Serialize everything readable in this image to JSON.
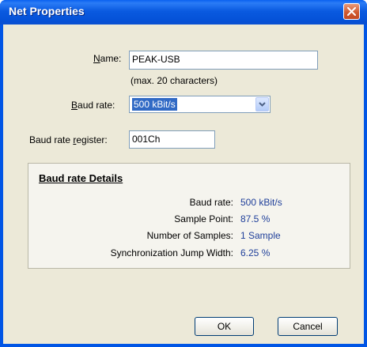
{
  "window": {
    "title": "Net Properties"
  },
  "form": {
    "name_label_prefix": "",
    "name_label_u": "N",
    "name_label_rest": "ame:",
    "name_value": "PEAK-USB",
    "name_hint": "(max. 20 characters)",
    "baud_label_u": "B",
    "baud_label_rest": "aud rate:",
    "baud_value": "500 kBit/s",
    "register_label_prefix": "Baud rate ",
    "register_label_u": "r",
    "register_label_rest": "egister:",
    "register_value": "001Ch"
  },
  "details": {
    "title": "Baud rate Details",
    "rows": [
      {
        "label": "Baud rate:",
        "value": "500 kBit/s"
      },
      {
        "label": "Sample Point:",
        "value": "87.5 %"
      },
      {
        "label": "Number of Samples:",
        "value": "1 Sample"
      },
      {
        "label": "Synchronization Jump Width:",
        "value": "6.25 %"
      }
    ]
  },
  "buttons": {
    "ok": "OK",
    "cancel": "Cancel"
  },
  "icons": {
    "close": "close-icon",
    "dropdown": "chevron-down-icon"
  },
  "colors": {
    "title_bar": "#0055e5",
    "selection": "#316ac5",
    "detail_value": "#1f3f9a"
  }
}
